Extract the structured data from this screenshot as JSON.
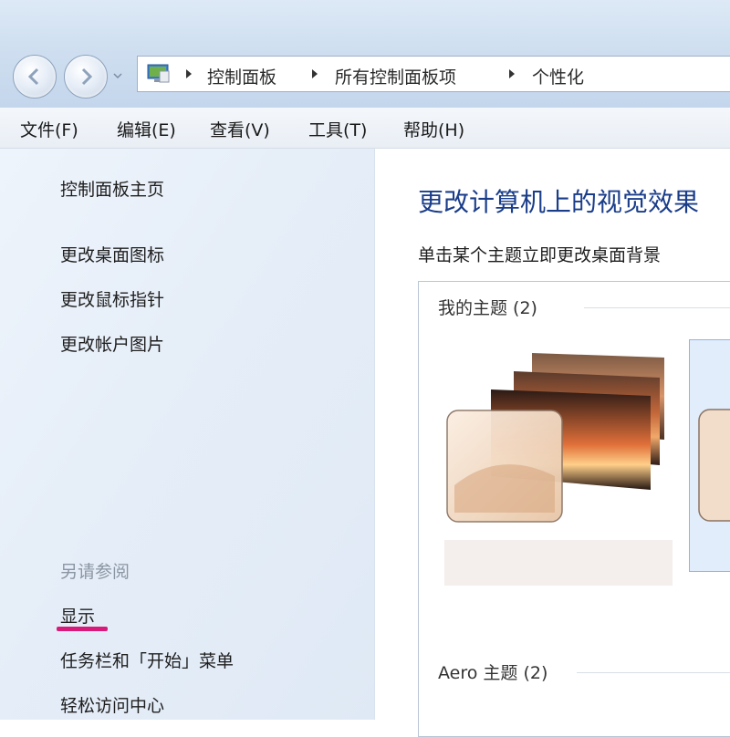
{
  "address": {
    "crumbs": [
      "控制面板",
      "所有控制面板项",
      "个性化"
    ]
  },
  "menu": [
    "文件(F)",
    "编辑(E)",
    "查看(V)",
    "工具(T)",
    "帮助(H)"
  ],
  "sidebar": {
    "home": "控制面板主页",
    "tasks": [
      "更改桌面图标",
      "更改鼠标指针",
      "更改帐户图片"
    ],
    "see_also_title": "另请参阅",
    "see_also": [
      "显示",
      "任务栏和「开始」菜单",
      "轻松访问中心"
    ]
  },
  "main": {
    "title": "更改计算机上的视觉效果",
    "subtitle": "单击某个主题立即更改桌面背景",
    "groups": [
      {
        "label": "我的主题 (2)"
      },
      {
        "label": "Aero 主题 (2)"
      }
    ]
  },
  "colors": {
    "accent_title": "#1a3d8a",
    "highlight_underline": "#d81b7a"
  }
}
